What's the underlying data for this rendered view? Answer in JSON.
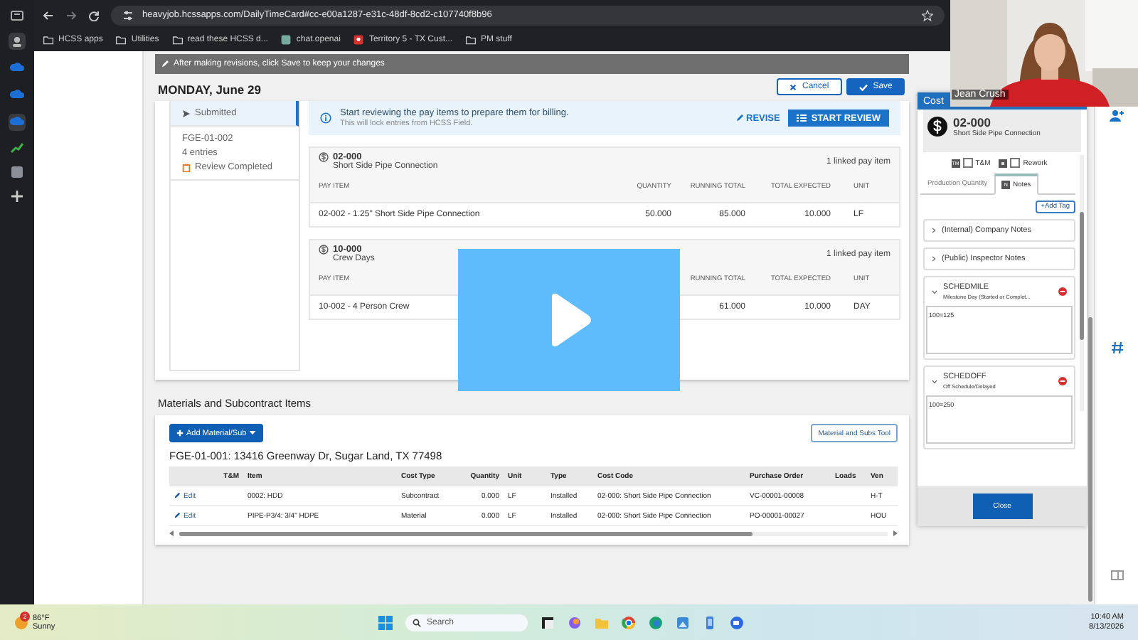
{
  "browser": {
    "url": "heavyjob.hcssapps.com/DailyTimeCard#cc-e00a1287-e31c-48df-8cd2-c107740f8b96",
    "bookmarks": [
      "HCSS apps",
      "Utilities",
      "read these HCSS d...",
      "chat.openai",
      "Territory 5 - TX Cust...",
      "PM stuff"
    ]
  },
  "notice": "After making revisions, click Save to keep your changes",
  "actions": {
    "cancel": "Cancel",
    "save": "Save"
  },
  "day_title": "MONDAY, June 29",
  "timecards": [
    {
      "kind": "submitted",
      "status": "Submitted",
      "selected": true
    },
    {
      "kind": "review-completed",
      "code": "FGE-01-002",
      "entries": "4 entries",
      "status": "Review Completed",
      "selected": false
    }
  ],
  "review_banner": {
    "message": "Start reviewing the pay items to prepare them for billing.",
    "note": "This will lock entries from HCSS Field.",
    "revise": "REVISE",
    "start": "START REVIEW"
  },
  "cost_codes": [
    {
      "code": "02-000",
      "name": "Short Side Pipe Connection",
      "linked": "1 linked pay item",
      "columns": {
        "pay_item": "PAY ITEM",
        "quantity": "QUANTITY",
        "running_total": "RUNNING TOTAL",
        "total_expected": "TOTAL EXPECTED",
        "unit": "UNIT"
      },
      "rows": [
        {
          "pay_item": "02-002 - 1.25\" Short Side Pipe Connection",
          "quantity": "50.000",
          "running_total": "85.000",
          "total_expected": "10.000",
          "unit": "LF"
        }
      ]
    },
    {
      "code": "10-000",
      "name": "Crew Days",
      "linked": "1 linked pay item",
      "columns": {
        "pay_item": "PAY ITEM",
        "running_total": "RUNNING TOTAL",
        "total_expected": "TOTAL EXPECTED",
        "unit": "UNIT"
      },
      "rows": [
        {
          "pay_item": "10-002 - 4 Person Crew",
          "running_total": "61.000",
          "total_expected": "10.000",
          "unit": "DAY"
        }
      ]
    }
  ],
  "materials": {
    "title": "Materials and Subcontract Items",
    "add_button": "Add Material/Sub",
    "tool_button": "Material and Subs Tool",
    "heading": "FGE-01-001: 13416 Greenway Dr, Sugar Land, TX 77498",
    "columns": [
      "T&M",
      "Item",
      "Cost Type",
      "Quantity",
      "Unit",
      "Type",
      "Cost Code",
      "Purchase Order",
      "Loads",
      "Ven"
    ],
    "rows": [
      {
        "action": "Edit",
        "item": "0002: HDD",
        "cost_type": "Subcontract",
        "quantity": "0.000",
        "unit": "LF",
        "type": "Installed",
        "cost_code": "02-000: Short Side Pipe Connection",
        "purchase_order": "VC-00001-00008",
        "vendor": "H-T"
      },
      {
        "action": "Edit",
        "item": "PIPE-P3/4: 3/4\" HDPE",
        "cost_type": "Material",
        "quantity": "0.000",
        "unit": "LF",
        "type": "Installed",
        "cost_code": "02-000: Short Side Pipe Connection",
        "purchase_order": "PO-00001-00027",
        "vendor": "HOU"
      }
    ]
  },
  "cost_panel": {
    "header": "Cost",
    "code": "02-000",
    "name": "Short Side Pipe Connection",
    "options": [
      {
        "badge": "TM",
        "label": "T&M",
        "checked": false
      },
      {
        "label": "Rework",
        "checked": false
      }
    ],
    "tabs": [
      {
        "label": "Production Quantity",
        "selected": false
      },
      {
        "badge": "N",
        "label": "Notes",
        "selected": true
      }
    ],
    "add_tag": "+Add Tag",
    "notes": [
      {
        "kind": "section",
        "title": "(Internal) Company Notes",
        "expanded": false
      },
      {
        "kind": "section",
        "title": "(Public) Inspector Notes",
        "expanded": false
      },
      {
        "kind": "tag",
        "title": "SCHEDMILE",
        "subtitle": "Milestone Day (Started or Complet...",
        "value": "100=125",
        "expanded": true
      },
      {
        "kind": "tag",
        "title": "SCHEDOFF",
        "subtitle": "Off Schedule/Delayed",
        "value": "100=250",
        "expanded": true
      }
    ],
    "close": "Close"
  },
  "webcam": {
    "name": "Jean Crush"
  },
  "taskbar": {
    "weather_badge": "2",
    "temperature": "86°F",
    "condition": "Sunny",
    "search_placeholder": "Search",
    "time": "10:40 AM",
    "date": "8/13/2026"
  }
}
